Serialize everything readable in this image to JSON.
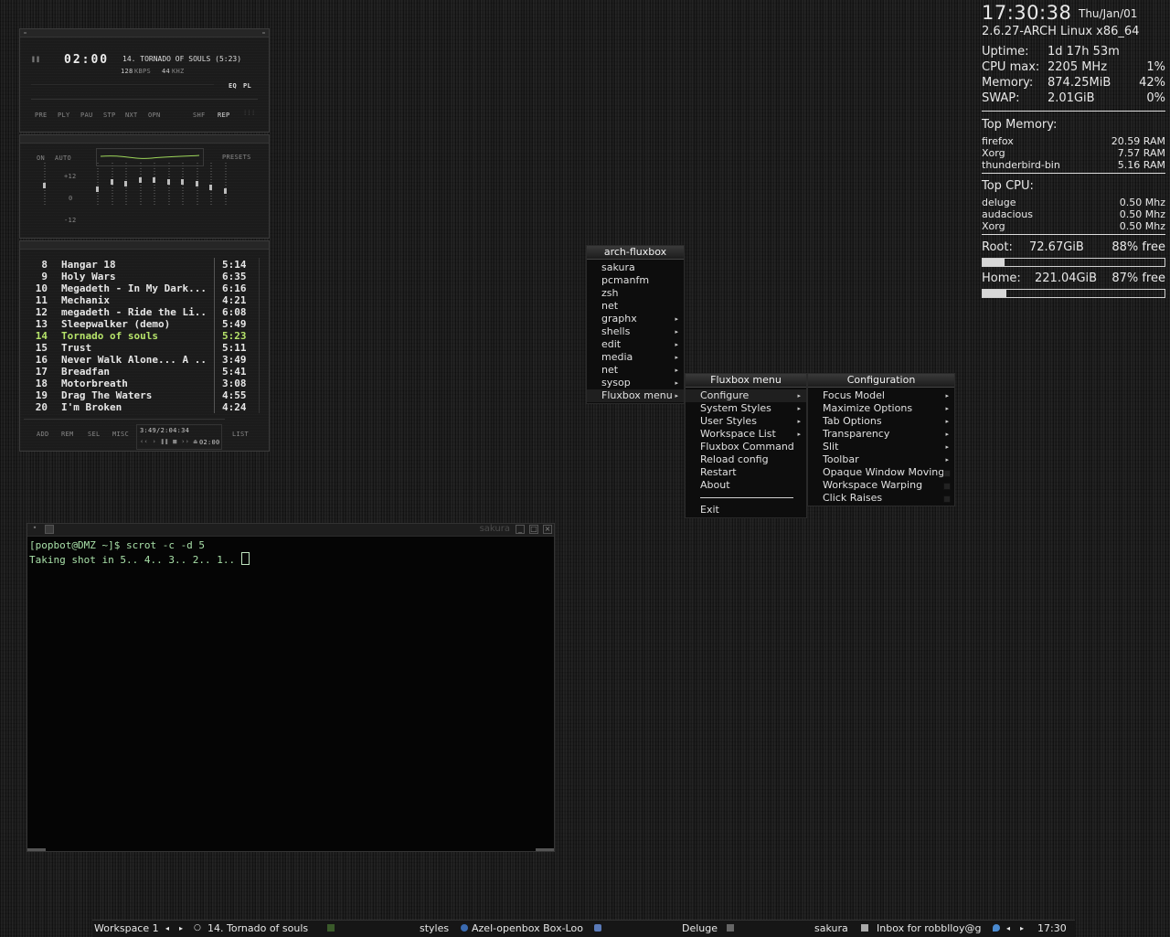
{
  "conky": {
    "time": "17:30:38",
    "date": "Thu/Jan/01",
    "kernel": "2.6.27-ARCH  Linux x86_64",
    "stats": [
      {
        "label": "Uptime:",
        "value": "1d 17h 53m",
        "extra": ""
      },
      {
        "label": "CPU max:",
        "value": "2205 MHz",
        "extra": "1%"
      },
      {
        "label": "Memory:",
        "value": "874.25MiB",
        "extra": "42%"
      },
      {
        "label": "SWAP:",
        "value": "2.01GiB",
        "extra": "0%"
      }
    ],
    "top_memory_label": "Top Memory:",
    "top_memory": [
      {
        "name": "firefox",
        "value": "20.59 RAM"
      },
      {
        "name": "Xorg",
        "value": "7.57 RAM"
      },
      {
        "name": "thunderbird-bin",
        "value": "5.16 RAM"
      }
    ],
    "top_cpu_label": "Top CPU:",
    "top_cpu": [
      {
        "name": "deluge",
        "value": "0.50 Mhz"
      },
      {
        "name": "audacious",
        "value": "0.50 Mhz"
      },
      {
        "name": "Xorg",
        "value": "0.50 Mhz"
      }
    ],
    "root": {
      "label": "Root:",
      "size": "72.67GiB",
      "free": "88% free",
      "used_fraction": 0.12
    },
    "home": {
      "label": "Home:",
      "size": "221.04GiB",
      "free": "87% free",
      "used_fraction": 0.13
    }
  },
  "audacious": {
    "time": "02:00",
    "track_title": "14. TORNADO OF SOULS (5:23)",
    "bitrate": "128",
    "kbps": "KBPS",
    "samplerate": "44",
    "khz": "KHZ",
    "eq_btn": "EQ",
    "pl_btn": "PL",
    "controls": [
      "PRE",
      "PLY",
      "PAU",
      "STP",
      "NXT",
      "OPN"
    ],
    "shf": "SHF",
    "rep": "REP",
    "eq": {
      "on": "ON",
      "auto": "AUTO",
      "presets": "PRESETS",
      "plus12": "+12",
      "zero": "0",
      "minus12": "-12",
      "band_levels": [
        0.45,
        0.35,
        0.55,
        0.5,
        0.6,
        0.6,
        0.55,
        0.55,
        0.5,
        0.4,
        0.3
      ]
    },
    "playlist": [
      {
        "num": "8",
        "title": "Hangar 18",
        "dur": "5:14"
      },
      {
        "num": "9",
        "title": "Holy Wars",
        "dur": "6:35"
      },
      {
        "num": "10",
        "title": "Megadeth - In My Dark...",
        "dur": "6:16"
      },
      {
        "num": "11",
        "title": "Mechanix",
        "dur": "4:21"
      },
      {
        "num": "12",
        "title": "megadeth - Ride the Li...",
        "dur": "6:08"
      },
      {
        "num": "13",
        "title": "Sleepwalker (demo)",
        "dur": "5:49"
      },
      {
        "num": "14",
        "title": "Tornado of souls",
        "dur": "5:23",
        "current": true
      },
      {
        "num": "15",
        "title": "Trust",
        "dur": "5:11"
      },
      {
        "num": "16",
        "title": "Never Walk Alone... A ...",
        "dur": "3:49"
      },
      {
        "num": "17",
        "title": "Breadfan",
        "dur": "5:41"
      },
      {
        "num": "18",
        "title": "Motorbreath",
        "dur": "3:08"
      },
      {
        "num": "19",
        "title": "Drag The Waters",
        "dur": "4:55"
      },
      {
        "num": "20",
        "title": "I'm Broken",
        "dur": "4:24"
      }
    ],
    "pl_buttons": [
      "ADD",
      "REM",
      "SEL",
      "MISC"
    ],
    "pl_total": "3:49/2:04:34",
    "pl_time": "02:00",
    "pl_list": "LIST"
  },
  "terminal": {
    "title": "sakura",
    "prompt_line": "[popbot@DMZ ~]$ scrot -c -d 5",
    "output_line": "Taking shot in 5.. 4.. 3.. 2.. 1.. "
  },
  "menus": {
    "root": {
      "title": "arch-fluxbox",
      "items": [
        {
          "label": "sakura",
          "sub": false
        },
        {
          "label": "pcmanfm",
          "sub": false
        },
        {
          "label": "zsh",
          "sub": false
        },
        {
          "label": "net",
          "sub": false
        },
        {
          "label": "graphx",
          "sub": true
        },
        {
          "label": "shells",
          "sub": true
        },
        {
          "label": "edit",
          "sub": true
        },
        {
          "label": "media",
          "sub": true
        },
        {
          "label": "net",
          "sub": true
        },
        {
          "label": "sysop",
          "sub": true
        },
        {
          "label": "Fluxbox menu",
          "sub": true,
          "selected": true
        }
      ]
    },
    "fluxbox": {
      "title": "Fluxbox menu",
      "items": [
        {
          "label": "Configure",
          "sub": true,
          "selected": true
        },
        {
          "label": "System Styles",
          "sub": true
        },
        {
          "label": "User Styles",
          "sub": true
        },
        {
          "label": "Workspace List",
          "sub": true
        },
        {
          "label": "Fluxbox Command",
          "sub": false
        },
        {
          "label": "Reload config",
          "sub": false
        },
        {
          "label": "Restart",
          "sub": false
        },
        {
          "label": "About",
          "sub": false
        }
      ],
      "exit": "Exit"
    },
    "config": {
      "title": "Configuration",
      "items": [
        {
          "label": "Focus Model",
          "sub": true
        },
        {
          "label": "Maximize Options",
          "sub": true
        },
        {
          "label": "Tab Options",
          "sub": true
        },
        {
          "label": "Transparency",
          "sub": true
        },
        {
          "label": "Slit",
          "sub": true
        },
        {
          "label": "Toolbar",
          "sub": true
        },
        {
          "label": "Opaque Window Moving",
          "check": true
        },
        {
          "label": "Workspace Warping",
          "check": true
        },
        {
          "label": "Click Raises",
          "check": true
        }
      ]
    }
  },
  "taskbar": {
    "workspace": "Workspace 1",
    "tasks": [
      "14. Tornado of souls",
      "styles",
      "Azel-openbox Box-Loo",
      "Deluge",
      "sakura",
      "Inbox for robblloy@g"
    ],
    "clock": "17:30"
  }
}
